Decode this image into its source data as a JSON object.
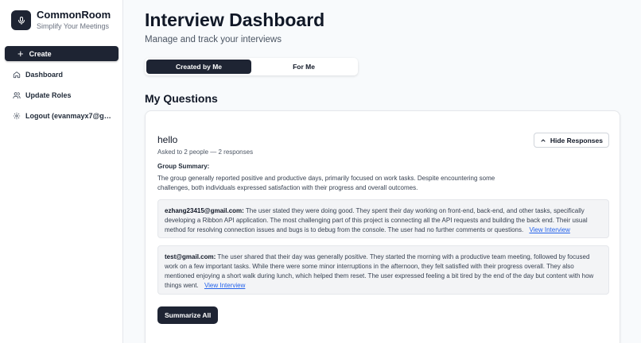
{
  "brand": {
    "name": "CommonRoom",
    "tagline": "Simplify Your Meetings"
  },
  "sidebar": {
    "create_label": "Create",
    "items": [
      {
        "label": "Dashboard",
        "icon": "home-icon"
      },
      {
        "label": "Update Roles",
        "icon": "users-icon"
      },
      {
        "label": "Logout (evanmayx7@gma...",
        "icon": "gear-icon"
      }
    ]
  },
  "header": {
    "title": "Interview Dashboard",
    "subtitle": "Manage and track your interviews"
  },
  "tabs": [
    {
      "label": "Created by Me",
      "active": true
    },
    {
      "label": "For Me",
      "active": false
    }
  ],
  "section": {
    "title": "My Questions"
  },
  "question": {
    "title": "hello",
    "meta": "Asked to 2 people — 2 responses",
    "hide_label": "Hide Responses",
    "group_summary_label": "Group Summary:",
    "group_summary": "The group generally reported positive and productive days, primarily focused on work tasks. Despite encountering some challenges, both individuals expressed satisfaction with their progress and overall outcomes.",
    "responses": [
      {
        "email": "ezhang23415@gmail.com:",
        "text": "The user stated they were doing good. They spent their day working on front-end, back-end, and other tasks, specifically developing a Ribbon API application. The most challenging part of this project is connecting all the API requests and building the back end. Their usual method for resolving connection issues and bugs is to debug from the console. The user had no further comments or questions.",
        "link": "View Interview"
      },
      {
        "email": "test@gmail.com:",
        "text": "The user shared that their day was generally positive. They started the morning with a productive team meeting, followed by focused work on a few important tasks. While there were some minor interruptions in the afternoon, they felt satisfied with their progress overall. They also mentioned enjoying a short walk during lunch, which helped them reset. The user expressed feeling a bit tired by the end of the day but content with how things went.",
        "link": "View Interview"
      }
    ],
    "summarize_label": "Summarize All"
  },
  "colors": {
    "primary_dark": "#1e2433",
    "link": "#2563eb"
  }
}
